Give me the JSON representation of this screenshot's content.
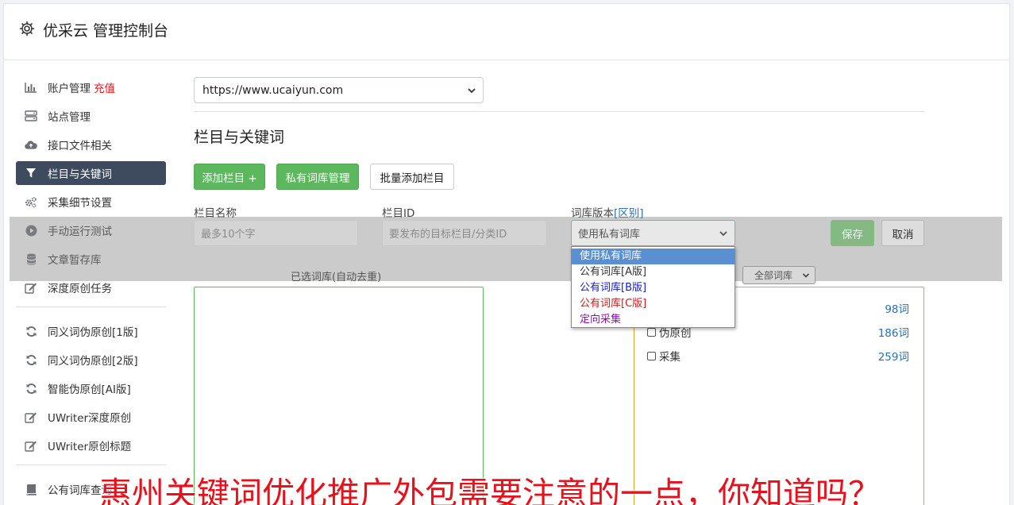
{
  "header": {
    "title": "优采云 管理控制台",
    "icon": "gear-icon"
  },
  "sidebar": {
    "items": [
      {
        "label": "账户管理",
        "extra": "充值",
        "icon": "bar-chart-icon"
      },
      {
        "label": "站点管理",
        "icon": "server-icon"
      },
      {
        "label": "接口文件相关",
        "icon": "cloud-upload-icon"
      },
      {
        "label": "栏目与关键词",
        "icon": "filter-icon",
        "active": true
      },
      {
        "label": "采集细节设置",
        "icon": "gears-icon"
      },
      {
        "label": "手动运行测试",
        "icon": "play-circle-icon"
      },
      {
        "label": "文章暂存库",
        "icon": "database-icon"
      },
      {
        "label": "深度原创任务",
        "icon": "edit-icon"
      }
    ],
    "items2": [
      {
        "label": "同义词伪原创[1版]",
        "icon": "refresh-icon"
      },
      {
        "label": "同义词伪原创[2版]",
        "icon": "refresh-icon"
      },
      {
        "label": "智能伪原创[AI版]",
        "icon": "refresh-icon"
      },
      {
        "label": "UWriter深度原创",
        "icon": "edit-icon"
      },
      {
        "label": "UWriter原创标题",
        "icon": "edit-icon"
      }
    ],
    "items3": [
      {
        "label": "公有词库查询",
        "icon": "book-icon"
      }
    ]
  },
  "main": {
    "site_select": "https://www.ucaiyun.com",
    "section_title": "栏目与关键词",
    "buttons": {
      "add_column": "添加栏目 +",
      "private_lib": "私有词库管理",
      "batch_add": "批量添加栏目"
    },
    "form": {
      "name_label": "栏目名称",
      "name_placeholder": "最多10个字",
      "id_label": "栏目ID",
      "id_placeholder": "要发布的目标栏目/分类ID",
      "version_label": "词库版本",
      "version_link": "[区别]",
      "version_value": "使用私有词库",
      "save": "保存",
      "cancel": "取消"
    },
    "version_options": [
      {
        "label": "使用私有词库",
        "color": "#ffffff",
        "highlight": true
      },
      {
        "label": "公有词库[A版]",
        "color": "#333333"
      },
      {
        "label": "公有词库[B版]",
        "color": "#1a1acc"
      },
      {
        "label": "公有词库[C版]",
        "color": "#d21b1b"
      },
      {
        "label": "定向采集",
        "color": "#8a12b0"
      }
    ],
    "selected_caption": "已选词库(自动去重)",
    "filter_select": "全部词库",
    "libraries": [
      {
        "name": "",
        "count": "98词"
      },
      {
        "name": "伪原创",
        "count": "186词"
      },
      {
        "name": "采集",
        "count": "259词"
      }
    ]
  },
  "banner": "惠州关键词优化推广外包需要注意的一点，你知道吗？",
  "colors": {
    "accent": "#5cb85c",
    "active_nav": "#3e4b5e",
    "link": "#2a6fb8",
    "banner": "#e8111b"
  }
}
